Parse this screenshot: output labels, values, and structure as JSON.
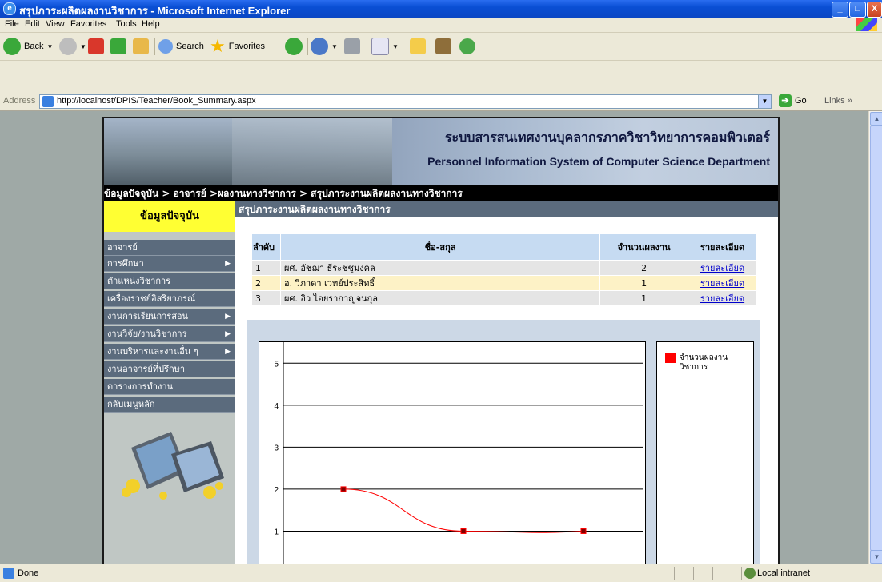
{
  "window": {
    "title": "สรุปภาระผลิตผลงานวิชาการ - Microsoft Internet Explorer",
    "min": "_",
    "max": "□",
    "close": "X"
  },
  "menu": [
    "File",
    "Edit",
    "View",
    "Favorites",
    "Tools",
    "Help"
  ],
  "toolbar": {
    "back": "Back",
    "search": "Search",
    "favorites": "Favorites"
  },
  "address": {
    "label": "Address",
    "url": "http://localhost/DPIS/Teacher/Book_Summary.aspx",
    "go": "Go",
    "links": "Links"
  },
  "status": {
    "left": "Done",
    "zone": "Local intranet"
  },
  "banner": {
    "thai": "ระบบสารสนเทศงานบุคลากรภาควิชาวิทยาการคอมพิวเตอร์",
    "english": "Personnel Information System of Computer Science Department"
  },
  "breadcrumb": "ข้อมูลปัจจุบัน > อาจารย์ >ผลงานทางวิชาการ > สรุปภาระงานผลิตผลงานทางวิชาการ",
  "sidebar": {
    "header": "ข้อมูลปัจจุบัน",
    "items": [
      {
        "label": "อาจารย์",
        "arrow": ""
      },
      {
        "label": "การศึกษา",
        "arrow": "▶"
      },
      {
        "label": "ตำแหน่งวิชาการ",
        "arrow": ""
      },
      {
        "label": "เครื่องราชย์อิสริยาภรณ์",
        "arrow": ""
      },
      {
        "label": "งานการเรียนการสอน",
        "arrow": "▶"
      },
      {
        "label": "งานวิจัย/งานวิชาการ",
        "arrow": "▶"
      },
      {
        "label": "งานบริหารและงานอื่น ๆ",
        "arrow": "▶"
      },
      {
        "label": "งานอาจารย์ที่ปรึกษา",
        "arrow": ""
      },
      {
        "label": "ตารางการทำงาน",
        "arrow": ""
      },
      {
        "label": "กลับเมนูหลัก",
        "arrow": ""
      }
    ]
  },
  "content": {
    "header": "สรุปภาระงานผลิตผลงานทางวิชาการ",
    "table": {
      "columns": [
        "ลำดับ",
        "ชื่อ-สกุล",
        "จำนวนผลงาน",
        "รายละเอียด"
      ],
      "rows": [
        [
          "1",
          "ผศ. อัชฌา ธีระชชูมงคล",
          "2",
          "รายละเอียด"
        ],
        [
          "2",
          "อ. วิภาดา เวทย์ประสิทธิ์",
          "1",
          "รายละเอียด"
        ],
        [
          "3",
          "ผศ. อิว ไอยรากาญจนกุล",
          "1",
          "รายละเอียด"
        ]
      ]
    }
  },
  "chart_data": {
    "type": "line",
    "x": [
      1,
      2,
      3
    ],
    "series": [
      {
        "name": "จำนวนผลงาน วิชาการ",
        "values": [
          2,
          1,
          1
        ],
        "color": "#ff0000"
      }
    ],
    "yticks": [
      1,
      2,
      3,
      4,
      5
    ],
    "ylim": [
      0,
      5.5
    ],
    "legend": "right",
    "grid": true
  }
}
